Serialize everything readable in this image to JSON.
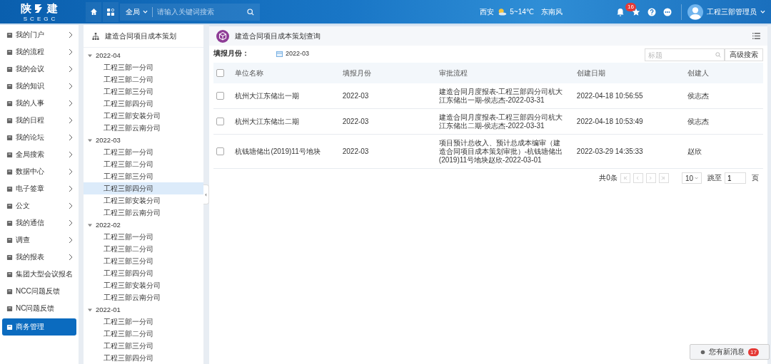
{
  "header": {
    "logo_left": "陕",
    "logo_right": "建",
    "logo_sub": "SCEGC",
    "scope": "全局",
    "search": {
      "placeholder": "请输入关键词搜索"
    },
    "weather": {
      "city": "西安",
      "temp": "5~14℃",
      "wind": "东南风"
    },
    "notifications": "16",
    "user": "工程三部管理员"
  },
  "sidebar": {
    "items": [
      {
        "label": "我的门户",
        "arrow": true,
        "selected": false
      },
      {
        "label": "我的流程",
        "arrow": true,
        "selected": false
      },
      {
        "label": "我的会议",
        "arrow": true,
        "selected": false
      },
      {
        "label": "我的知识",
        "arrow": true,
        "selected": false
      },
      {
        "label": "我的人事",
        "arrow": true,
        "selected": false
      },
      {
        "label": "我的日程",
        "arrow": true,
        "selected": false
      },
      {
        "label": "我的论坛",
        "arrow": true,
        "selected": false
      },
      {
        "label": "全局搜索",
        "arrow": true,
        "selected": false
      },
      {
        "label": "数据中心",
        "arrow": true,
        "selected": false
      },
      {
        "label": "电子签章",
        "arrow": true,
        "selected": false
      },
      {
        "label": "公文",
        "arrow": true,
        "selected": false
      },
      {
        "label": "我的通信",
        "arrow": true,
        "selected": false
      },
      {
        "label": "调查",
        "arrow": true,
        "selected": false
      },
      {
        "label": "我的报表",
        "arrow": true,
        "selected": false
      },
      {
        "label": "集团大型会议报名",
        "arrow": false,
        "selected": false
      },
      {
        "label": "NCC问题反馈",
        "arrow": false,
        "selected": false
      },
      {
        "label": "NC问题反馈",
        "arrow": false,
        "selected": false
      },
      {
        "label": "商务管理",
        "arrow": false,
        "selected": true
      }
    ]
  },
  "tree": {
    "title": "建造合同项目成本策划",
    "nodes": [
      {
        "label": "2022-04",
        "expanded": true,
        "children": [
          {
            "label": "工程三部一分司",
            "selected": false
          },
          {
            "label": "工程三部二分司",
            "selected": false
          },
          {
            "label": "工程三部三分司",
            "selected": false
          },
          {
            "label": "工程三部四分司",
            "selected": false
          },
          {
            "label": "工程三部安装分司",
            "selected": false
          },
          {
            "label": "工程三部云南分司",
            "selected": false
          }
        ]
      },
      {
        "label": "2022-03",
        "expanded": true,
        "children": [
          {
            "label": "工程三部一分司",
            "selected": false
          },
          {
            "label": "工程三部二分司",
            "selected": false
          },
          {
            "label": "工程三部三分司",
            "selected": false
          },
          {
            "label": "工程三部四分司",
            "selected": true
          },
          {
            "label": "工程三部安装分司",
            "selected": false
          },
          {
            "label": "工程三部云南分司",
            "selected": false
          }
        ]
      },
      {
        "label": "2022-02",
        "expanded": true,
        "children": [
          {
            "label": "工程三部一分司",
            "selected": false
          },
          {
            "label": "工程三部二分司",
            "selected": false
          },
          {
            "label": "工程三部三分司",
            "selected": false
          },
          {
            "label": "工程三部四分司",
            "selected": false
          },
          {
            "label": "工程三部安装分司",
            "selected": false
          },
          {
            "label": "工程三部云南分司",
            "selected": false
          }
        ]
      },
      {
        "label": "2022-01",
        "expanded": true,
        "children": [
          {
            "label": "工程三部一分司",
            "selected": false
          },
          {
            "label": "工程三部二分司",
            "selected": false
          },
          {
            "label": "工程三部三分司",
            "selected": false
          },
          {
            "label": "工程三部四分司",
            "selected": false
          }
        ]
      }
    ]
  },
  "main": {
    "title": "建造合同项目成本策划查询",
    "filter_label": "填报月份：",
    "filter_value": "2022-03",
    "search": {
      "placeholder": "标题"
    },
    "advanced_button": "高级搜索",
    "table": {
      "columns": [
        "单位名称",
        "填报月份",
        "审批流程",
        "创建日期",
        "创建人"
      ],
      "header_checked": false,
      "rows": [
        {
          "checked": false,
          "cells": [
            "杭州大江东储出一期",
            "2022-03",
            "建造合同月度报表-工程三部四分司杭大江东储出一期-侯志杰-2022-03-31",
            "2022-04-18 10:56:55",
            "侯志杰"
          ]
        },
        {
          "checked": false,
          "cells": [
            "杭州大江东储出二期",
            "2022-03",
            "建造合同月度报表-工程三部四分司杭大江东储出二期-侯志杰-2022-03-31",
            "2022-04-18 10:53:49",
            "侯志杰"
          ]
        },
        {
          "checked": false,
          "cells": [
            "杭钱塘储出(2019)11号地块",
            "2022-03",
            "项目预计总收入、预计总成本编审（建造合同项目成本策划审批）-杭钱塘储出(2019)11号地块赵欣-2022-03-01",
            "2022-03-29 14:35:33",
            "赵欣"
          ]
        }
      ]
    },
    "pagination": {
      "total": "共0条",
      "page_size": "10",
      "jump_label": "跳至",
      "page": "1",
      "page_unit": "页"
    }
  },
  "message": {
    "label": "您有新消息",
    "count": "17"
  }
}
